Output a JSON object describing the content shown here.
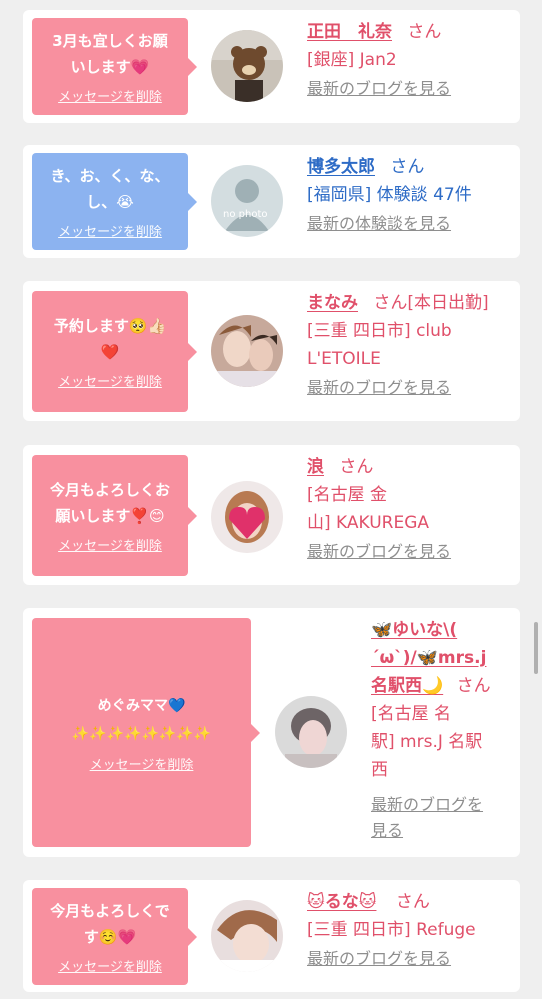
{
  "cards": [
    {
      "message": "3月も宜しくお願\nいします💗",
      "delete_label": "メッセージを削除",
      "name": "正田　礼奈",
      "honorific": "さん",
      "location": "[銀座] Jan2",
      "blog_link": "最新のブログを見る"
    },
    {
      "message": "き、お、く、な、\nし、😭",
      "delete_label": "メッセージを削除",
      "name": "博多太郎",
      "honorific": "さん",
      "location": "[福岡県] 体験談 47件",
      "blog_link": "最新の体験談を見る"
    },
    {
      "message": "予約します🥺👍🏻\n❤️",
      "delete_label": "メッセージを削除",
      "name": "まなみ",
      "honorific": "さん[本日出勤]",
      "location": "[三重 四日市] club\nL'ETOILE",
      "blog_link": "最新のブログを見る"
    },
    {
      "message": "今月もよろしくお\n願いします❣️😊",
      "delete_label": "メッセージを削除",
      "name": "浪",
      "honorific": "さん",
      "location": "[名古屋 金\n山] KAKUREGA",
      "blog_link": "最新のブログを見る"
    },
    {
      "message": "めぐみママ💙\n✨✨✨✨✨✨✨✨",
      "delete_label": "メッセージを削除",
      "name": "🦋ゆいな\\(\n´ω`)/🦋mrs.j\n名駅西🌙",
      "honorific": "さん",
      "location": "[名古屋 名\n駅] mrs.J 名駅\n西",
      "blog_link": "最新のブログを\n見る"
    },
    {
      "message": "今月もよろしくで\nす☺️💗",
      "delete_label": "メッセージを削除",
      "name": "🐱るな🐱",
      "honorific": "さん",
      "location": "[三重 四日市] Refuge",
      "blog_link": "最新のブログを見る"
    }
  ],
  "photo_placeholder": "no photo",
  "colors": {
    "pink": "#f8909f",
    "blue": "#8cb3f0",
    "link_pink": "#e0506a",
    "link_blue": "#2d6bc6",
    "gray": "#8e8e8e"
  }
}
